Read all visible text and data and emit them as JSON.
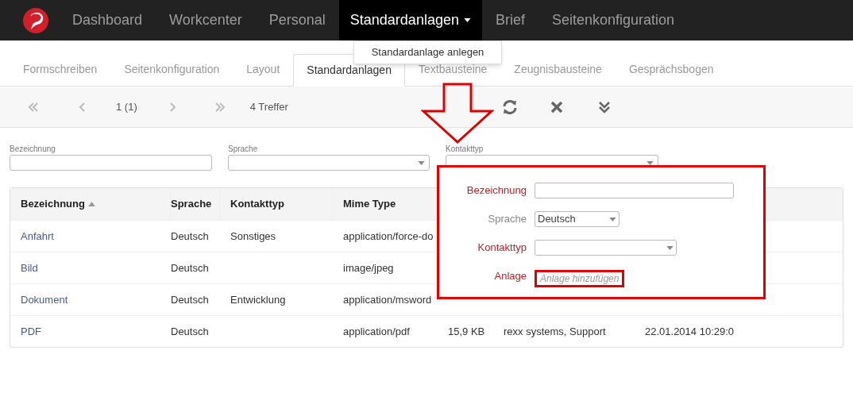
{
  "navbar": {
    "items": [
      {
        "label": "Dashboard",
        "selected": false,
        "dropdown": false
      },
      {
        "label": "Workcenter",
        "selected": false,
        "dropdown": false
      },
      {
        "label": "Personal",
        "selected": false,
        "dropdown": false
      },
      {
        "label": "Standardanlagen",
        "selected": true,
        "dropdown": true
      },
      {
        "label": "Brief",
        "selected": false,
        "dropdown": false
      },
      {
        "label": "Seitenkonfiguration",
        "selected": false,
        "dropdown": false
      }
    ],
    "dropdown_menu": [
      "Standardanlage anlegen"
    ]
  },
  "tabs": [
    {
      "label": "Formschreiben",
      "selected": false
    },
    {
      "label": "Seitenkonfiguration",
      "selected": false
    },
    {
      "label": "Layout",
      "selected": false
    },
    {
      "label": "Standardanlagen",
      "selected": true
    },
    {
      "label": "Textbausteine",
      "selected": false
    },
    {
      "label": "Zeugnisbausteine",
      "selected": false
    },
    {
      "label": "Gesprächsbogen",
      "selected": false
    }
  ],
  "pager": {
    "page": "1 (1)",
    "hits": "4 Treffer"
  },
  "filters": [
    {
      "label": "Bezeichnung",
      "kind": "text"
    },
    {
      "label": "Sprache",
      "kind": "select"
    },
    {
      "label": "Kontakttyp",
      "kind": "select"
    }
  ],
  "table": {
    "columns": [
      {
        "label": "Bezeichnung",
        "sorted": true
      },
      {
        "label": "Sprache",
        "sorted": false
      },
      {
        "label": "Kontakttyp",
        "sorted": false
      },
      {
        "label": "Mime Type",
        "sorted": false
      }
    ],
    "rows": [
      {
        "cells": [
          "Anfahrt",
          "Deutsch",
          "Sonstiges",
          "application/force-do"
        ]
      },
      {
        "cells": [
          "Bild",
          "Deutsch",
          "",
          "image/jpeg"
        ]
      },
      {
        "cells": [
          "Dokument",
          "Deutsch",
          "Entwicklung",
          "application/msword"
        ]
      },
      {
        "cells": [
          "PDF",
          "Deutsch",
          "",
          "application/pdf",
          "15,9 KB",
          "rexx systems, Support",
          "22.01.2014 10:29:0"
        ]
      }
    ]
  },
  "form": {
    "fields": [
      {
        "label": "Bezeichnung",
        "kind": "text",
        "required": true
      },
      {
        "label": "Sprache",
        "kind": "select",
        "required": false,
        "value": "Deutsch"
      },
      {
        "label": "Kontakttyp",
        "kind": "select",
        "required": true
      },
      {
        "label": "Anlage",
        "kind": "link",
        "required": true,
        "link": "Anlage hinzufügen"
      }
    ]
  }
}
